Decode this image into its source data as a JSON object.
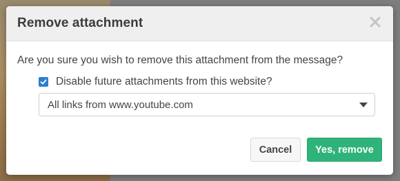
{
  "dialog": {
    "title": "Remove attachment",
    "close_icon": "close-icon",
    "message": "Are you sure you wish to remove this attachment from the message?",
    "checkbox": {
      "label": "Disable future attachments from this website?",
      "checked": true,
      "color": "#2d7fd0"
    },
    "select": {
      "value": "All links from www.youtube.com",
      "caret_icon": "caret-down-icon"
    },
    "buttons": {
      "cancel_label": "Cancel",
      "confirm_label": "Yes, remove",
      "confirm_color": "#2fb37a"
    }
  }
}
